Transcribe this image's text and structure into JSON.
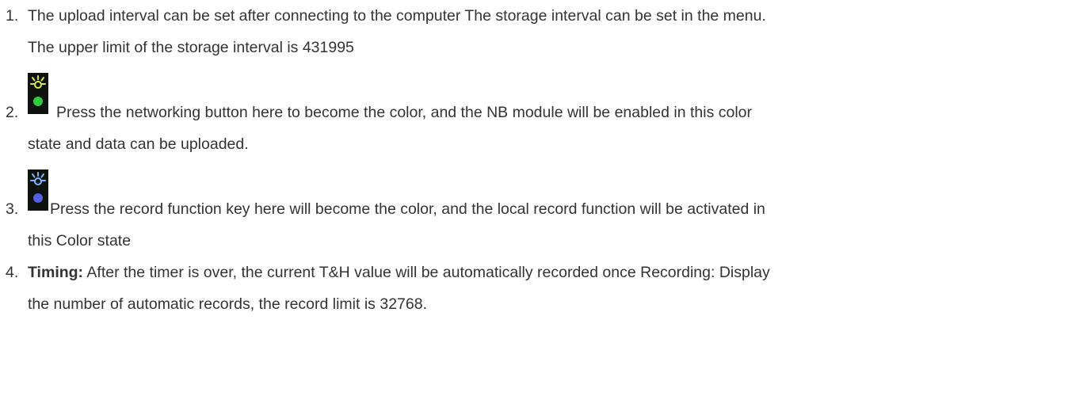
{
  "items": [
    {
      "number": "1.",
      "lines": [
        "The upload interval can be set after connecting to the computer The storage interval can be set in the menu.",
        "The upper limit of the storage interval is 431995"
      ]
    },
    {
      "number": "2.",
      "icon": "green-led-icon",
      "lines": [
        "Press the networking button here to become the color, and the NB module will be enabled in this color",
        "state and data can be uploaded."
      ]
    },
    {
      "number": "3.",
      "icon": "blue-led-icon",
      "lines": [
        "Press the record function key here will become the color, and the local record function will be activated in",
        "this Color state"
      ]
    },
    {
      "number": "4.",
      "bold_label": "Timing:",
      "lines": [
        "After the timer is over, the current T&H value will be automatically recorded once Recording: Display",
        "the number of automatic records, the record limit is 32768."
      ]
    }
  ],
  "colors": {
    "text": "#333333",
    "icon_bg": "#0e120c",
    "green_led": "#2ecc40",
    "green_rays": "#d8e84a",
    "blue_led": "#5560e0",
    "blue_rays": "#7fb6ff"
  }
}
